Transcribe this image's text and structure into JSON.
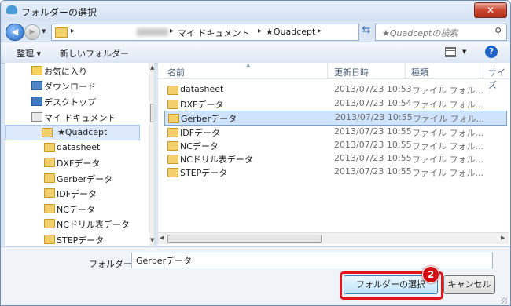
{
  "window": {
    "title": "フォルダーの選択",
    "close_label": "✕"
  },
  "navbar": {
    "breadcrumbs": [
      "マイ ドキュメント",
      "★Quadcept"
    ],
    "search_placeholder": "★Quadceptの検索"
  },
  "toolbar": {
    "organize_label": "整理 ▾",
    "new_folder_label": "新しいフォルダー"
  },
  "nav_pane": {
    "items": [
      {
        "label": "お気に入り",
        "icon": "favorites-icon"
      },
      {
        "label": "ダウンロード",
        "icon": "downloads-icon"
      },
      {
        "label": "デスクトップ",
        "icon": "desktop-icon"
      },
      {
        "label": "マイ ドキュメント",
        "icon": "documents-icon"
      },
      {
        "label": "★Quadcept",
        "icon": "folder-icon",
        "selected": true
      },
      {
        "label": "datasheet",
        "icon": "folder-icon"
      },
      {
        "label": "DXFデータ",
        "icon": "folder-icon"
      },
      {
        "label": "Gerberデータ",
        "icon": "folder-icon"
      },
      {
        "label": "IDFデータ",
        "icon": "folder-icon"
      },
      {
        "label": "NCデータ",
        "icon": "folder-icon"
      },
      {
        "label": "NCドリル表データ",
        "icon": "folder-icon"
      },
      {
        "label": "STEPデータ",
        "icon": "folder-icon"
      }
    ]
  },
  "file_list": {
    "columns": [
      "名前",
      "更新日時",
      "種類",
      "サイズ"
    ],
    "rows": [
      {
        "name": "datasheet",
        "date": "2013/07/23 10:53",
        "type": "ファイル フォル..."
      },
      {
        "name": "DXFデータ",
        "date": "2013/07/23 10:54",
        "type": "ファイル フォル..."
      },
      {
        "name": "Gerberデータ",
        "date": "2013/07/23 10:55",
        "type": "ファイル フォル...",
        "selected": true
      },
      {
        "name": "IDFデータ",
        "date": "2013/07/23 10:55",
        "type": "ファイル フォル..."
      },
      {
        "name": "NCデータ",
        "date": "2013/07/23 10:55",
        "type": "ファイル フォル..."
      },
      {
        "name": "NCドリル表データ",
        "date": "2013/07/23 10:55",
        "type": "ファイル フォル..."
      },
      {
        "name": "STEPデータ",
        "date": "2013/07/23 10:55",
        "type": "ファイル フォル..."
      }
    ]
  },
  "footer": {
    "folder_label": "フォルダー:",
    "folder_value": "Gerberデータ",
    "select_label": "フォルダーの選択",
    "cancel_label": "キャンセル",
    "step_badge": "2"
  },
  "colors": {
    "selection": "#cfe3fc",
    "highlight": "#e3141c",
    "titlebar": "#dbe6f4"
  }
}
